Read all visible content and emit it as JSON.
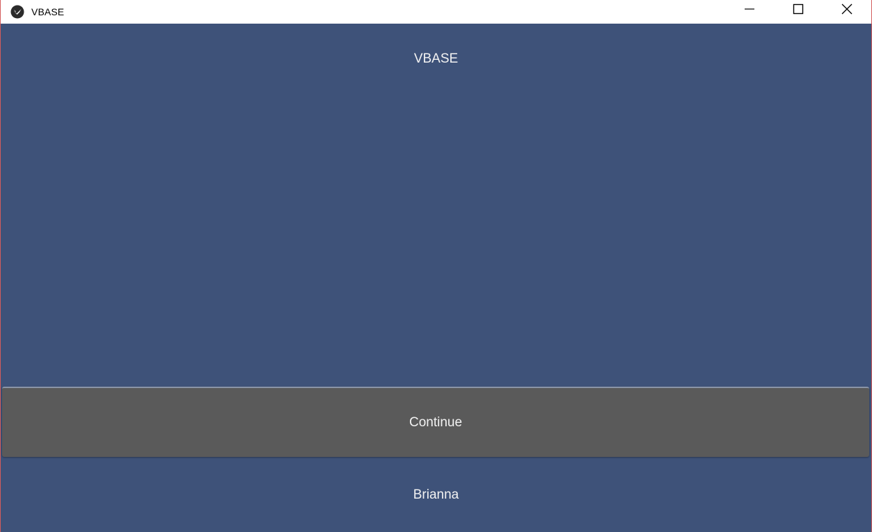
{
  "window": {
    "title": "VBASE",
    "app_icon": "kivy-logo-icon",
    "controls": {
      "minimize_icon": "minimize-icon",
      "maximize_icon": "maximize-icon",
      "close_icon": "close-icon"
    }
  },
  "main": {
    "heading": "VBASE",
    "continue_label": "Continue",
    "user_name": "Brianna"
  },
  "colors": {
    "background": "#3e5279",
    "button": "#5a5a5a",
    "text": "#f2f2f2",
    "titlebar": "#ffffff"
  }
}
